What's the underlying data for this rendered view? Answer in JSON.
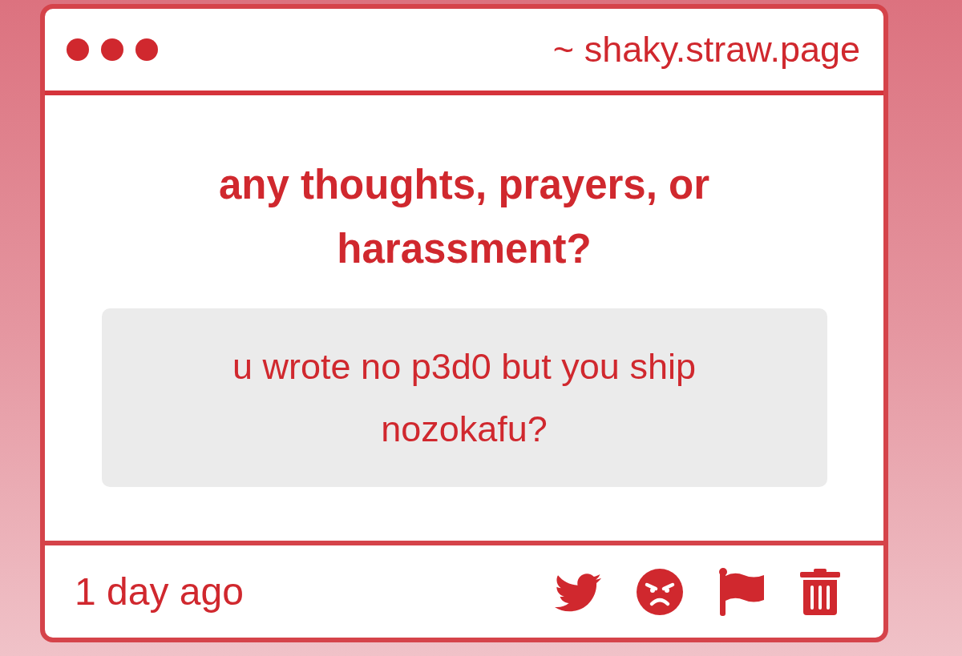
{
  "header": {
    "title": "~ shaky.straw.page"
  },
  "question": {
    "prompt": "any thoughts, prayers, or harassment?",
    "answer": "u wrote no p3d0 but you ship nozokafu?"
  },
  "footer": {
    "time": "1 day ago"
  }
}
